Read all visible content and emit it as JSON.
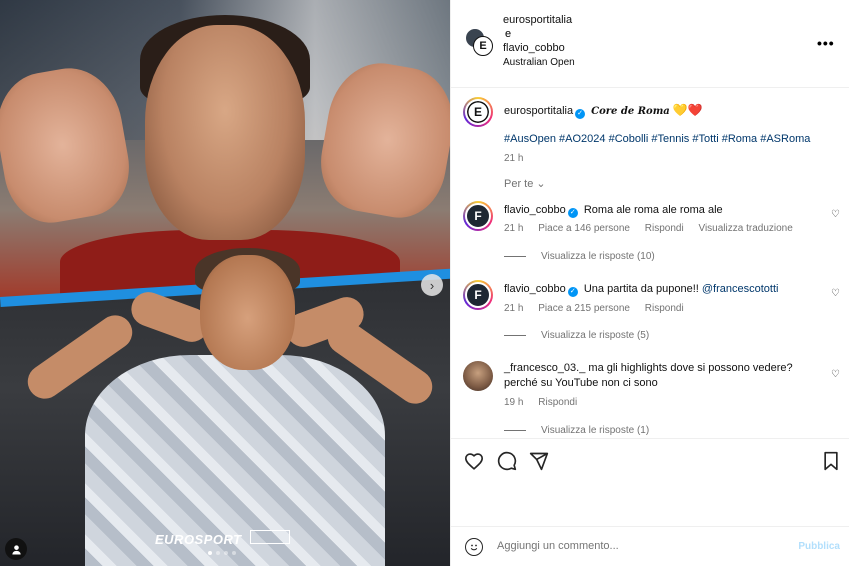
{
  "post": {
    "collab_user_1": "eurosportitalia",
    "collab_joiner": "e",
    "collab_user_2": "flavio_cobbo",
    "location": "Australian Open",
    "more_icon": "more-horizontal-icon"
  },
  "media": {
    "watermark": "EUROSPORT",
    "carousel_count": 4,
    "carousel_active": 1,
    "next_icon": "chevron-right-icon",
    "tag_icon": "user-tag-icon"
  },
  "caption": {
    "username": "eurosportitalia",
    "verified": true,
    "text": "Core de Roma",
    "emoji_1": "💛",
    "emoji_2": "❤️",
    "hashtags": "#AusOpen #AO2024 #Cobolli #Tennis #Totti #Roma #ASRoma",
    "time": "21 h"
  },
  "sort_label": "Per te",
  "comments": [
    {
      "username": "flavio_cobbo",
      "verified": true,
      "text": "Roma ale roma ale roma ale",
      "time": "21 h",
      "likes": "Piace a 146 persone",
      "reply": "Rispondi",
      "translate": "Visualizza traduzione",
      "view_replies": "Visualizza le risposte (10)"
    },
    {
      "username": "flavio_cobbo",
      "verified": true,
      "text": "Una partita da pupone!!",
      "mention": "@francescototti",
      "time": "21 h",
      "likes": "Piace a 215 persone",
      "reply": "Rispondi",
      "view_replies": "Visualizza le risposte (5)"
    },
    {
      "username": "_francesco_03._",
      "verified": false,
      "text": "ma gli highlights dove si possono vedere? perché su YouTube non ci sono",
      "time": "19 h",
      "reply": "Rispondi",
      "view_replies": "Visualizza le risposte (1)"
    }
  ],
  "actions": {
    "like_icon": "heart-icon",
    "comment_icon": "comment-icon",
    "share_icon": "send-icon",
    "save_icon": "bookmark-icon"
  },
  "add_comment": {
    "placeholder": "Aggiungi un commento...",
    "publish": "Pubblica",
    "emoji_icon": "smiley-icon"
  },
  "colors": {
    "link": "#00376b",
    "verified": "#0095f6",
    "muted": "#737373",
    "publish_disabled": "#b2dffc",
    "divider_blue": "#1f8fe0"
  }
}
